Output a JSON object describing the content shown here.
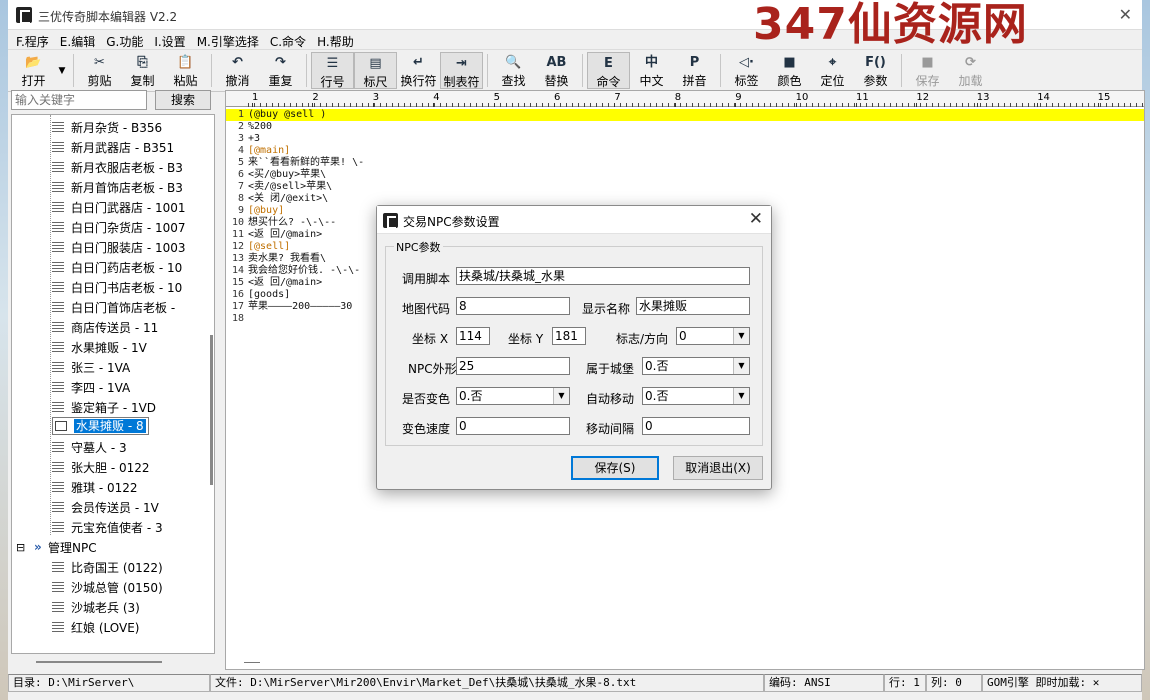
{
  "window": {
    "title": "三优传奇脚本编辑器 V2.2",
    "watermark": "347仙资源网"
  },
  "menu": [
    "F.程序",
    "E.编辑",
    "G.功能",
    "I.设置",
    "M.引擎选择",
    "C.命令",
    "H.帮助"
  ],
  "toolbar": [
    {
      "label": "打开",
      "icon": "folder-open-icon",
      "glyph": "📂"
    },
    {
      "label": "剪贴",
      "icon": "scissors-icon",
      "glyph": "✂"
    },
    {
      "label": "复制",
      "icon": "copy-icon",
      "glyph": "⎘"
    },
    {
      "label": "粘贴",
      "icon": "paste-icon",
      "glyph": "📋"
    },
    {
      "label": "撤消",
      "icon": "undo-icon",
      "glyph": "↶"
    },
    {
      "label": "重复",
      "icon": "redo-icon",
      "glyph": "↷"
    },
    {
      "label": "行号",
      "icon": "line-number-icon",
      "glyph": "☰"
    },
    {
      "label": "标尺",
      "icon": "ruler-icon",
      "glyph": "▤"
    },
    {
      "label": "换行符",
      "icon": "line-break-icon",
      "glyph": "↵"
    },
    {
      "label": "制表符",
      "icon": "tab-icon",
      "glyph": "⇥"
    },
    {
      "label": "查找",
      "icon": "find-icon",
      "glyph": "🔍"
    },
    {
      "label": "替换",
      "icon": "replace-icon",
      "glyph": "AB"
    },
    {
      "label": "命令",
      "icon": "command-icon",
      "glyph": "E"
    },
    {
      "label": "中文",
      "icon": "chinese-icon",
      "glyph": "中"
    },
    {
      "label": "拼音",
      "icon": "pinyin-icon",
      "glyph": "P"
    },
    {
      "label": "标签",
      "icon": "tag-icon",
      "glyph": "◁·"
    },
    {
      "label": "颜色",
      "icon": "color-icon",
      "glyph": "■"
    },
    {
      "label": "定位",
      "icon": "locate-icon",
      "glyph": "⌖"
    },
    {
      "label": "参数",
      "icon": "params-icon",
      "glyph": "F()"
    },
    {
      "label": "保存",
      "icon": "save-icon",
      "glyph": "■"
    },
    {
      "label": "加载",
      "icon": "load-icon",
      "glyph": "⟳"
    }
  ],
  "search": {
    "placeholder": "输入关键字",
    "button": "搜索"
  },
  "tree": {
    "items": [
      "新月杂货 - B356",
      "新月武器店 - B351",
      "新月衣服店老板 - B3",
      "新月首饰店老板 - B3",
      "白日门武器店 - 1001",
      "白日门杂货店 - 1007",
      "白日门服装店 - 1003",
      "白日门药店老板 - 10",
      "白日门书店老板 - 10",
      "白日门首饰店老板 -",
      "商店传送员 - 11",
      "水果摊贩 - 1V",
      "张三 - 1VA",
      "李四 - 1VA",
      "鉴定箱子 - 1VD",
      "水果摊贩 - 8",
      "守墓人 - 3",
      "张大胆 - 0122",
      "雅琪 - 0122",
      "会员传送员 - 1V",
      "元宝充值使者 - 3"
    ],
    "group": {
      "label": "管理NPC",
      "toggle": "⊟",
      "marker": "»"
    },
    "group_items": [
      "比奇国王  (0122)",
      "沙城总管  (0150)",
      "沙城老兵  (3)",
      "红娘  (LOVE)"
    ]
  },
  "ruler": [
    "1",
    "2",
    "3",
    "4",
    "5",
    "6",
    "7",
    "8",
    "9",
    "10",
    "11",
    "12",
    "13",
    "14",
    "15"
  ],
  "code": [
    {
      "n": "1",
      "t": "(@buy @sell )"
    },
    {
      "n": "2",
      "t": "%200"
    },
    {
      "n": "3",
      "t": "+3"
    },
    {
      "n": "4",
      "t": "[@main]"
    },
    {
      "n": "5",
      "t": "来``看看新鲜的苹果! \\-"
    },
    {
      "n": "6",
      "t": "<买/@buy>苹果\\"
    },
    {
      "n": "7",
      "t": "<卖/@sell>苹果\\"
    },
    {
      "n": "8",
      "t": "<关 闭/@exit>\\"
    },
    {
      "n": "9",
      "t": "[@buy]"
    },
    {
      "n": "10",
      "t": "想买什么? -\\-\\--"
    },
    {
      "n": "11",
      "t": "<返 回/@main>"
    },
    {
      "n": "12",
      "t": "[@sell]"
    },
    {
      "n": "13",
      "t": "卖水果? 我看看\\"
    },
    {
      "n": "14",
      "t": "我会给您好价钱. -\\-\\-"
    },
    {
      "n": "15",
      "t": "<返 回/@main>"
    },
    {
      "n": "16",
      "t": "[goods]"
    },
    {
      "n": "17",
      "t": "苹果————200—————30"
    },
    {
      "n": "18",
      "t": ""
    }
  ],
  "status": {
    "dir": "目录: D:\\MirServer\\",
    "file": "文件: D:\\MirServer\\Mir200\\Envir\\Market_Def\\扶桑城\\扶桑城_水果-8.txt",
    "encoding": "编码: ANSI",
    "row": "行: 1",
    "col": "列: 0",
    "engine": "GOM引擎  即时加载: ✕"
  },
  "dialog": {
    "title": "交易NPC参数设置",
    "group_label": "NPC参数",
    "labels": {
      "script": "调用脚本",
      "map": "地图代码",
      "display_name": "显示名称",
      "x": "坐标 X",
      "y": "坐标 Y",
      "flag": "标志/方向",
      "appearance": "NPC外形",
      "castle": "属于城堡",
      "color_change": "是否变色",
      "auto_move": "自动移动",
      "color_speed": "变色速度",
      "move_interval": "移动间隔"
    },
    "values": {
      "script": "扶桑城/扶桑城_水果",
      "map": "8",
      "display_name": "水果摊贩",
      "x": "114",
      "y": "181",
      "flag": "0",
      "appearance": "25",
      "castle": "0.否",
      "color_change": "0.否",
      "auto_move": "0.否",
      "color_speed": "0",
      "move_interval": "0"
    },
    "save": "保存(S)",
    "cancel": "取消退出(X)"
  }
}
